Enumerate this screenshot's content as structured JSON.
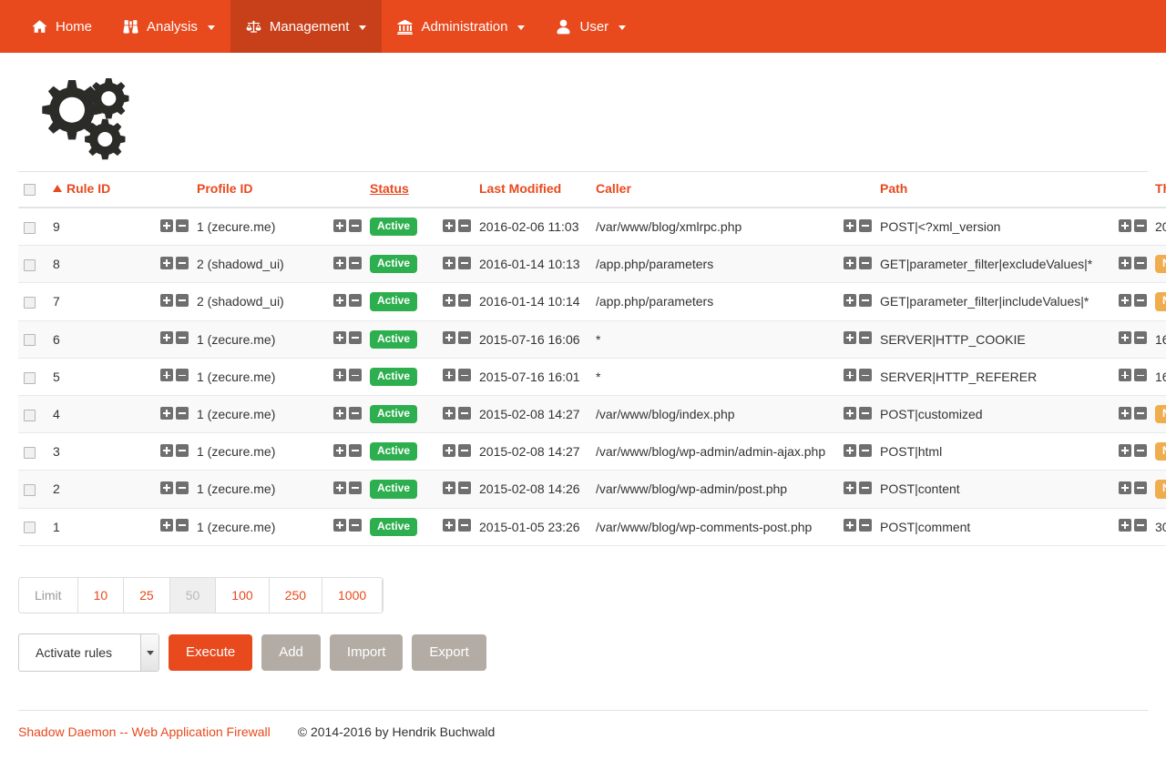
{
  "navbar": {
    "items": [
      {
        "label": "Home",
        "icon": "home-icon",
        "caret": false,
        "active": false
      },
      {
        "label": "Analysis",
        "icon": "binoculars-icon",
        "caret": true,
        "active": false
      },
      {
        "label": "Management",
        "icon": "scales-icon",
        "caret": true,
        "active": true
      },
      {
        "label": "Administration",
        "icon": "bank-icon",
        "caret": true,
        "active": false
      },
      {
        "label": "User",
        "icon": "user-icon",
        "caret": true,
        "active": false
      }
    ],
    "bg_color": "#e8491d",
    "active_bg_color": "#c8401a"
  },
  "logo": {
    "name": "gears-logo",
    "color": "#2b2b28"
  },
  "table": {
    "headers": {
      "select_all": "",
      "rule_id": "Rule ID",
      "profile_id": "Profile ID",
      "status": "Status",
      "last_modified": "Last Modified",
      "caller": "Caller",
      "path": "Path",
      "threshold": "Threshold"
    },
    "sort": {
      "column": "Rule ID",
      "direction": "asc",
      "glyph": "▲"
    },
    "rows": [
      {
        "rule_id": "9",
        "profile_id": "1 (zecure.me)",
        "status": "Active",
        "status_type": "success",
        "last_modified": "2016-02-06 11:03",
        "caller": "/var/www/blog/xmlrpc.php",
        "path": "POST|<?xml_version",
        "threshold": "20",
        "threshold_type": "plain"
      },
      {
        "rule_id": "8",
        "profile_id": "2 (shadowd_ui)",
        "status": "Active",
        "status_type": "success",
        "last_modified": "2016-01-14 10:13",
        "caller": "/app.php/parameters",
        "path": "GET|parameter_filter|excludeValues|*",
        "threshold": "No limitation",
        "threshold_type": "warn"
      },
      {
        "rule_id": "7",
        "profile_id": "2 (shadowd_ui)",
        "status": "Active",
        "status_type": "success",
        "last_modified": "2016-01-14 10:14",
        "caller": "/app.php/parameters",
        "path": "GET|parameter_filter|includeValues|*",
        "threshold": "No limitation",
        "threshold_type": "warn"
      },
      {
        "rule_id": "6",
        "profile_id": "1 (zecure.me)",
        "status": "Active",
        "status_type": "success",
        "last_modified": "2015-07-16 16:06",
        "caller": "*",
        "path": "SERVER|HTTP_COOKIE",
        "threshold": "16",
        "threshold_type": "plain"
      },
      {
        "rule_id": "5",
        "profile_id": "1 (zecure.me)",
        "status": "Active",
        "status_type": "success",
        "last_modified": "2015-07-16 16:01",
        "caller": "*",
        "path": "SERVER|HTTP_REFERER",
        "threshold": "16",
        "threshold_type": "plain"
      },
      {
        "rule_id": "4",
        "profile_id": "1 (zecure.me)",
        "status": "Active",
        "status_type": "success",
        "last_modified": "2015-02-08 14:27",
        "caller": "/var/www/blog/index.php",
        "path": "POST|customized",
        "threshold": "No limitation",
        "threshold_type": "warn"
      },
      {
        "rule_id": "3",
        "profile_id": "1 (zecure.me)",
        "status": "Active",
        "status_type": "success",
        "last_modified": "2015-02-08 14:27",
        "caller": "/var/www/blog/wp-admin/admin-ajax.php",
        "path": "POST|html",
        "threshold": "No limitation",
        "threshold_type": "warn"
      },
      {
        "rule_id": "2",
        "profile_id": "1 (zecure.me)",
        "status": "Active",
        "status_type": "success",
        "last_modified": "2015-02-08 14:26",
        "caller": "/var/www/blog/wp-admin/post.php",
        "path": "POST|content",
        "threshold": "No limitation",
        "threshold_type": "warn"
      },
      {
        "rule_id": "1",
        "profile_id": "1 (zecure.me)",
        "status": "Active",
        "status_type": "success",
        "last_modified": "2015-01-05 23:26",
        "caller": "/var/www/blog/wp-comments-post.php",
        "path": "POST|comment",
        "threshold": "30",
        "threshold_type": "plain"
      }
    ],
    "filter_icons": {
      "add": "plus-icon",
      "remove": "minus-icon"
    },
    "row_action_icon": "edit-pencil-icon",
    "colors": {
      "header_text": "#e8491d",
      "badge_success": "#2eaf4f",
      "badge_warn": "#f0ad4e"
    }
  },
  "pager": {
    "label": "Limit",
    "options": [
      "10",
      "25",
      "50",
      "100",
      "250",
      "1000"
    ],
    "selected": "50"
  },
  "actions": {
    "select_value": "Activate rules",
    "select_name": "bulk-action-select",
    "execute": "Execute",
    "add": "Add",
    "import": "Import",
    "export": "Export"
  },
  "footer": {
    "brand": "Shadow Daemon -- Web Application Firewall",
    "copyright": "© 2014-2016 by Hendrik Buchwald"
  }
}
